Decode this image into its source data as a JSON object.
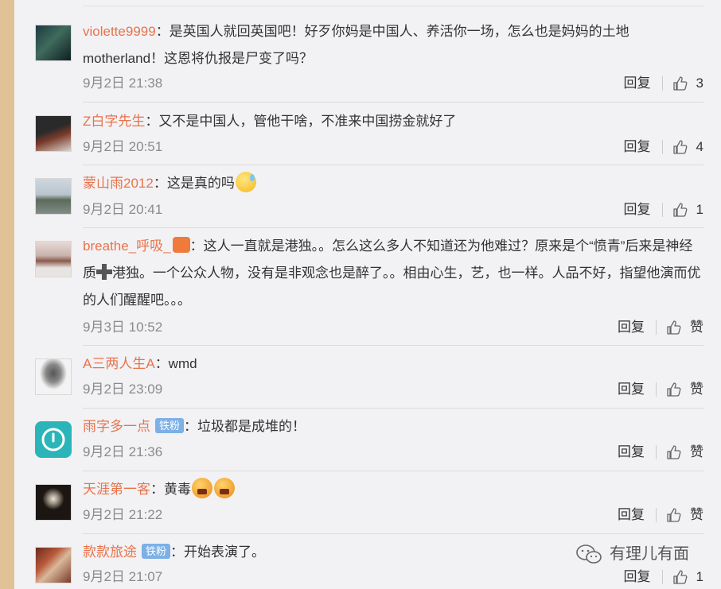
{
  "comments": [
    {
      "user": "violette9999",
      "text": "：是英国人就回英国吧！好歹你妈是中国人、养活你一场，怎么也是妈妈的土地motherland！这恩将仇报是尸变了吗？",
      "time": "9月2日 21:38",
      "reply": "回复",
      "likes": "3"
    },
    {
      "user": "Z白字先生",
      "text": "：又不是中国人，管他干啥，不准来中国捞金就好了",
      "time": "9月2日 20:51",
      "reply": "回复",
      "likes": "4"
    },
    {
      "user": "蒙山雨2012",
      "text": "：这是真的吗",
      "time": "9月2日 20:41",
      "reply": "回复",
      "likes": "1"
    },
    {
      "user": "breathe_呼吸_",
      "text_a": "：这人一直就是港独。。怎么这么多人不知道还为他难过？原来是个“愤青”后来是神经质",
      "text_b": "港独。一个公众人物，没有是非观念也是醉了。。相由心生，艺，也一样。人品不好，指望他演而优的人们醒醒吧。。。",
      "time": "9月3日 10:52",
      "reply": "回复",
      "likes": "赞"
    },
    {
      "user": "A三两人生A",
      "text": "：wmd",
      "time": "9月2日 23:09",
      "reply": "回复",
      "likes": "赞"
    },
    {
      "user": "雨字多一点",
      "tag": "铁粉",
      "text": "：垃圾都是成堆的！",
      "time": "9月2日 21:36",
      "reply": "回复",
      "likes": "赞"
    },
    {
      "user": "天涯第一客",
      "text": "：黄毒",
      "time": "9月2日 21:22",
      "reply": "回复",
      "likes": "赞"
    },
    {
      "user": "款款旅途",
      "tag": "铁粉",
      "text": "：开始表演了。",
      "time": "9月2日 21:07",
      "reply": "回复",
      "likes": "1"
    }
  ],
  "watermark": "有理儿有面",
  "icons": [
    "thumbs-up-icon",
    "wechat-icon",
    "sweat-emoji",
    "angry-emoji",
    "plus-icon"
  ]
}
